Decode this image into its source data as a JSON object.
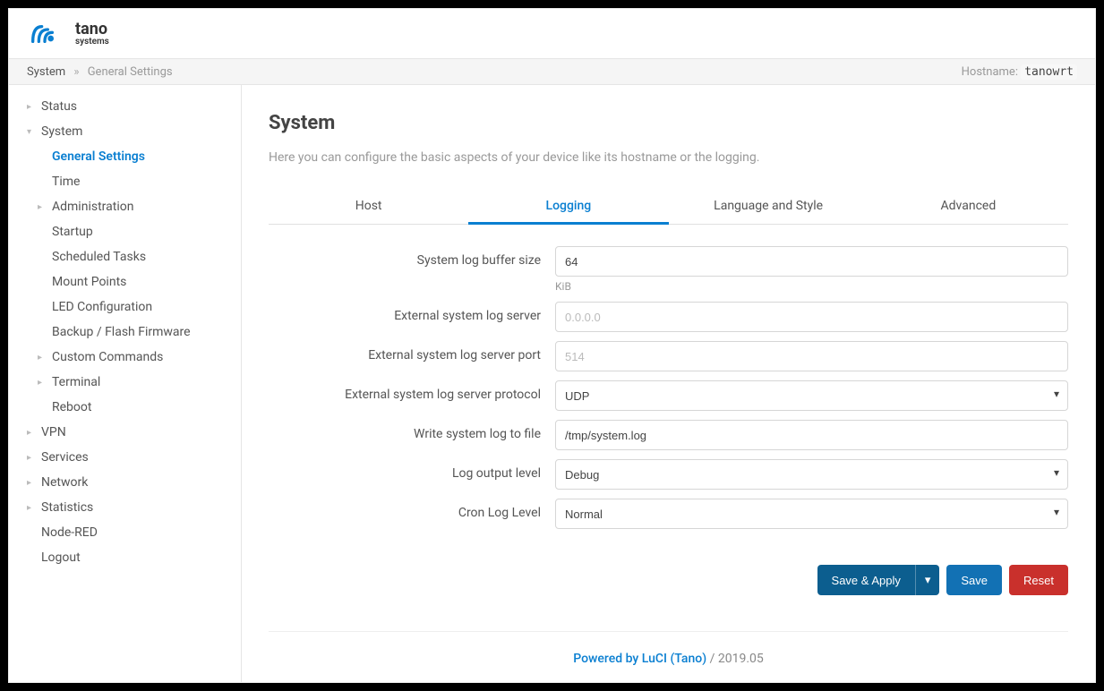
{
  "brand": {
    "name": "tano",
    "sub": "systems"
  },
  "breadcrumb": {
    "root": "System",
    "current": "General Settings"
  },
  "hostname_label": "Hostname:",
  "hostname": "tanowrt",
  "sidebar": {
    "status": "Status",
    "system": "System",
    "system_children": {
      "general_settings": "General Settings",
      "time": "Time",
      "administration": "Administration",
      "startup": "Startup",
      "scheduled_tasks": "Scheduled Tasks",
      "mount_points": "Mount Points",
      "led_config": "LED Configuration",
      "backup_flash": "Backup / Flash Firmware",
      "custom_commands": "Custom Commands",
      "terminal": "Terminal",
      "reboot": "Reboot"
    },
    "vpn": "VPN",
    "services": "Services",
    "network": "Network",
    "statistics": "Statistics",
    "node_red": "Node-RED",
    "logout": "Logout"
  },
  "page": {
    "title": "System",
    "desc": "Here you can configure the basic aspects of your device like its hostname or the logging."
  },
  "tabs": {
    "host": "Host",
    "logging": "Logging",
    "language": "Language and Style",
    "advanced": "Advanced"
  },
  "form": {
    "buffer_size": {
      "label": "System log buffer size",
      "value": "64",
      "hint": "KiB"
    },
    "ext_server": {
      "label": "External system log server",
      "placeholder": "0.0.0.0",
      "value": ""
    },
    "ext_port": {
      "label": "External system log server port",
      "placeholder": "514",
      "value": ""
    },
    "ext_proto": {
      "label": "External system log server protocol",
      "value": "UDP"
    },
    "write_file": {
      "label": "Write system log to file",
      "value": "/tmp/system.log"
    },
    "out_level": {
      "label": "Log output level",
      "value": "Debug"
    },
    "cron_level": {
      "label": "Cron Log Level",
      "value": "Normal"
    }
  },
  "actions": {
    "save_apply": "Save & Apply",
    "save": "Save",
    "reset": "Reset"
  },
  "footer": {
    "link": "Powered by LuCI (Tano)",
    "version": "/ 2019.05"
  }
}
